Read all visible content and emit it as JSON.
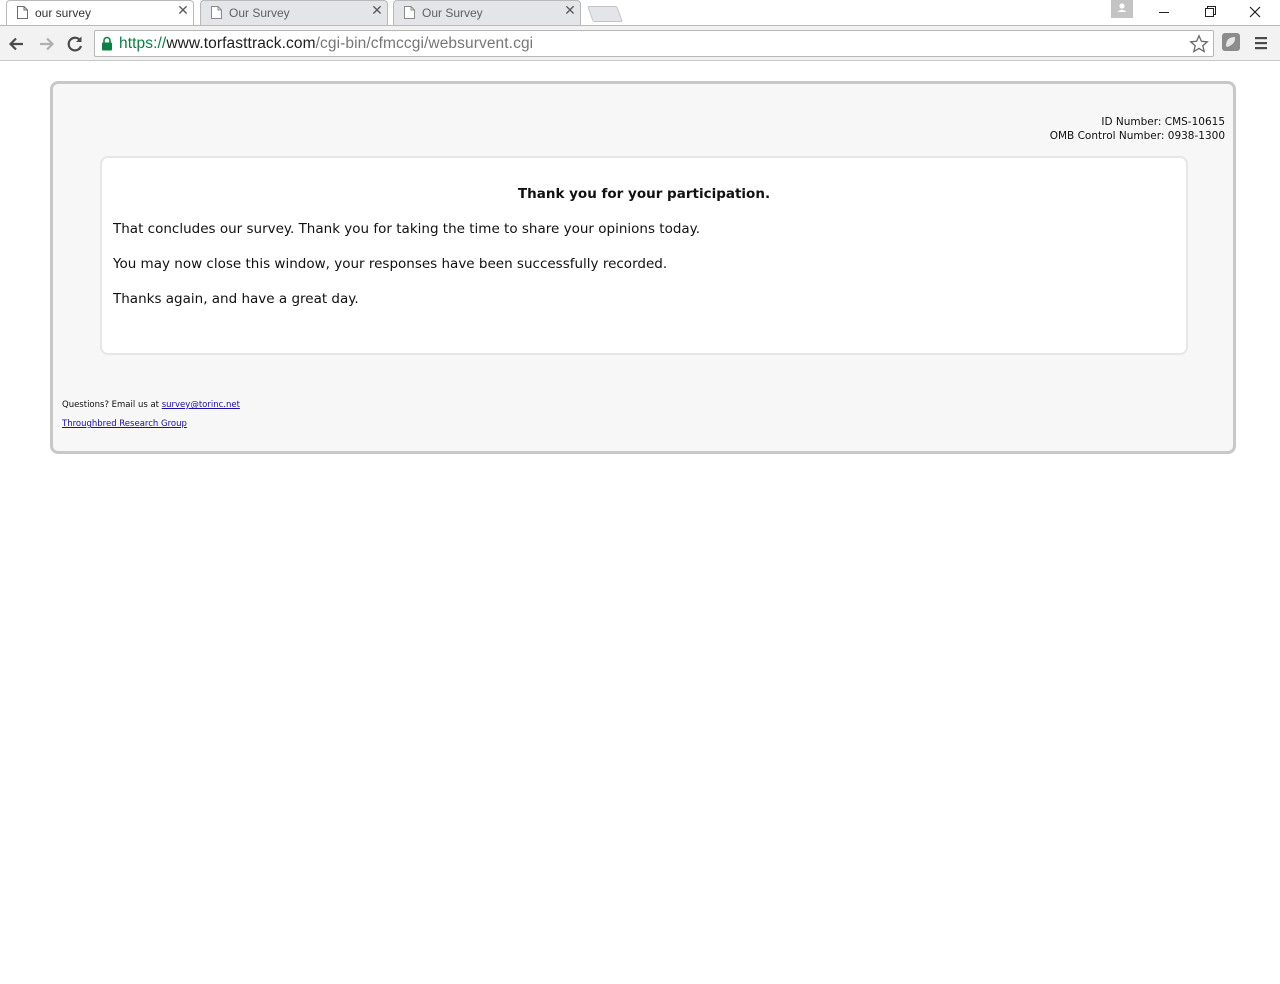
{
  "browser": {
    "tabs": [
      {
        "title": "our survey",
        "active": true
      },
      {
        "title": "Our Survey",
        "active": false
      },
      {
        "title": "Our Survey",
        "active": false
      }
    ],
    "tab_close_glyph": "✕",
    "url": {
      "scheme": "https://",
      "host": "www.torfasttrack.com",
      "path": "/cgi-bin/cfmccgi/websurvent.cgi"
    },
    "colors": {
      "secure_green": "#0b8043",
      "tab_inactive": "#e3e5e8"
    }
  },
  "survey": {
    "id_number": "ID Number: CMS-10615",
    "omb_number": "OMB Control Number: 0938-1300",
    "title": "Thank you for your participation.",
    "paragraphs": [
      "That concludes our survey. Thank you for taking the time to share your opinions today.",
      "You may now close this window, your responses have been successfully recorded.",
      "Thanks again, and have a great day."
    ]
  },
  "footer": {
    "questions_prefix": "Questions? Email us at ",
    "email_link": "survey@torinc.net",
    "company_link": "Throughbred Research Group"
  }
}
